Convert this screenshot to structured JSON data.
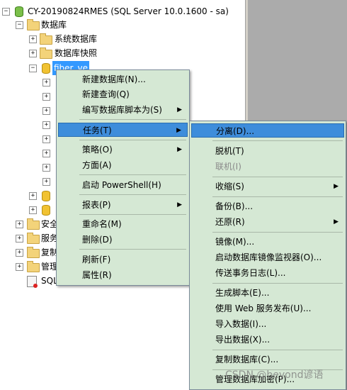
{
  "tree": {
    "server": "CY-20190824RMES (SQL Server 10.0.1600 - sa)",
    "databases": "数据库",
    "system_databases": "系统数据库",
    "snapshots": "数据库快照",
    "selected_db": "fiber_ve",
    "security": "安全",
    "server_objects": "服务",
    "replication": "复制",
    "management": "管理",
    "sql_agent": "SQL"
  },
  "context_menu": {
    "new_database": "新建数据库(N)...",
    "new_query": "新建查询(Q)",
    "script_database": "编写数据库脚本为(S)",
    "tasks": "任务(T)",
    "policies": "策略(O)",
    "facets": "方面(A)",
    "powershell": "启动 PowerShell(H)",
    "reports": "报表(P)",
    "rename": "重命名(M)",
    "delete": "删除(D)",
    "refresh": "刷新(F)",
    "properties": "属性(R)"
  },
  "tasks_menu": {
    "detach": "分离(D)...",
    "take_offline": "脱机(T)",
    "bring_online": "联机(I)",
    "shrink": "收缩(S)",
    "backup": "备份(B)...",
    "restore": "还原(R)",
    "mirror": "镜像(M)...",
    "mirror_monitor": "启动数据库镜像监视器(O)...",
    "log_shipping": "传送事务日志(L)...",
    "generate_scripts": "生成脚本(E)...",
    "publish_web": "使用 Web 服务发布(U)...",
    "import_data": "导入数据(I)...",
    "export_data": "导出数据(X)...",
    "copy_database": "复制数据库(C)...",
    "manage_encryption": "管理数据库加密(P)..."
  },
  "watermark": "CSDN @beyond谚语",
  "colors": {
    "menu_bg": "#d5e8d4",
    "highlight": "#3e8ddb",
    "selection": "#3399ff",
    "grey_pane": "#ababab"
  }
}
